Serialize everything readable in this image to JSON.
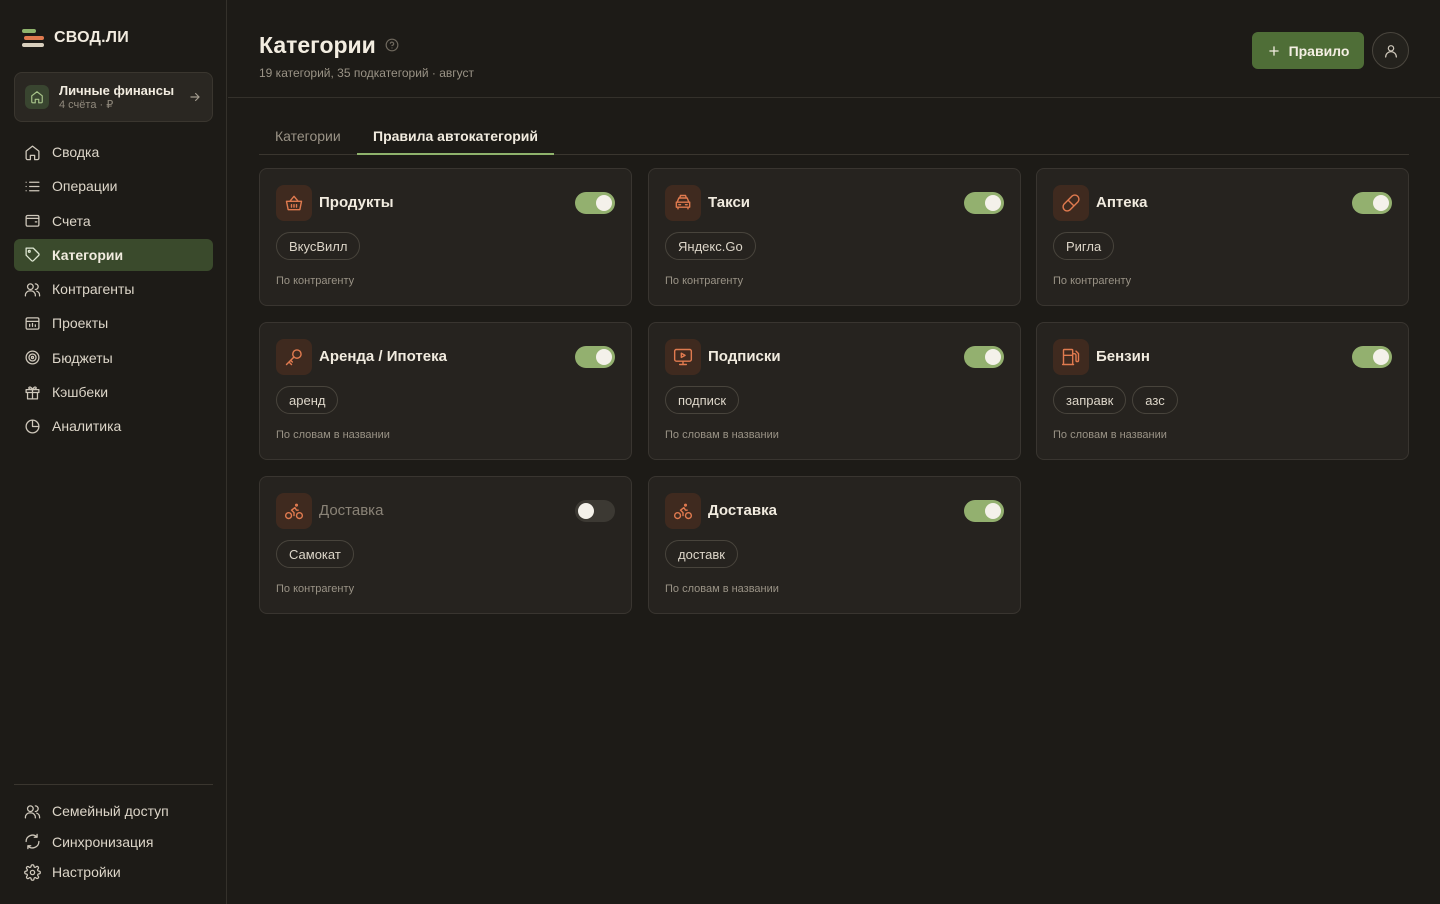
{
  "app": {
    "logo_text": "СВОД.ЛИ",
    "account": {
      "name": "Личные финансы",
      "sub": "4 счёта · ₽"
    }
  },
  "nav": {
    "items": [
      {
        "label": "Сводка",
        "icon": "home-icon"
      },
      {
        "label": "Операции",
        "icon": "list-icon"
      },
      {
        "label": "Счета",
        "icon": "wallet-icon"
      },
      {
        "label": "Категории",
        "icon": "tag-icon",
        "active": true
      },
      {
        "label": "Контрагенты",
        "icon": "users-icon"
      },
      {
        "label": "Проекты",
        "icon": "folder-icon"
      },
      {
        "label": "Бюджеты",
        "icon": "target-icon"
      },
      {
        "label": "Кэшбеки",
        "icon": "gift-icon"
      },
      {
        "label": "Аналитика",
        "icon": "pie-chart-icon"
      }
    ],
    "bottom": [
      {
        "label": "Семейный доступ",
        "icon": "users-icon"
      },
      {
        "label": "Синхронизация",
        "icon": "sync-icon"
      },
      {
        "label": "Настройки",
        "icon": "gear-icon"
      }
    ]
  },
  "header": {
    "title": "Категории",
    "subtitle": "19 категорий, 35 подкатегорий · август",
    "add_button": "Правило"
  },
  "tabs": [
    {
      "label": "Категории",
      "active": false
    },
    {
      "label": "Правила автокатегорий",
      "active": true
    }
  ],
  "rules": [
    {
      "title": "Продукты",
      "icon": "basket-icon",
      "enabled": true,
      "chips": [
        "ВкусВилл"
      ],
      "type": "По контрагенту"
    },
    {
      "title": "Такси",
      "icon": "car-icon",
      "enabled": true,
      "chips": [
        "Яндекс.Go"
      ],
      "type": "По контрагенту"
    },
    {
      "title": "Аптека",
      "icon": "pill-icon",
      "enabled": true,
      "chips": [
        "Ригла"
      ],
      "type": "По контрагенту"
    },
    {
      "title": "Аренда / Ипотека",
      "icon": "key-icon",
      "enabled": true,
      "chips": [
        "аренд"
      ],
      "type": "По словам в названии"
    },
    {
      "title": "Подписки",
      "icon": "monitor-play-icon",
      "enabled": true,
      "chips": [
        "подписк"
      ],
      "type": "По словам в названии"
    },
    {
      "title": "Бензин",
      "icon": "fuel-icon",
      "enabled": true,
      "chips": [
        "заправк",
        "азс"
      ],
      "type": "По словам в названии"
    },
    {
      "title": "Доставка",
      "icon": "bike-icon",
      "enabled": false,
      "chips": [
        "Самокат"
      ],
      "type": "По контрагенту"
    },
    {
      "title": "Доставка",
      "icon": "bike-icon",
      "enabled": true,
      "chips": [
        "доставк"
      ],
      "type": "По словам в названии"
    }
  ],
  "colors": {
    "accent_green": "#4f6e37",
    "toggle_on": "#93b06f",
    "icon_orange": "#e07a4f",
    "background": "#1d1b17",
    "card": "#26231f"
  }
}
